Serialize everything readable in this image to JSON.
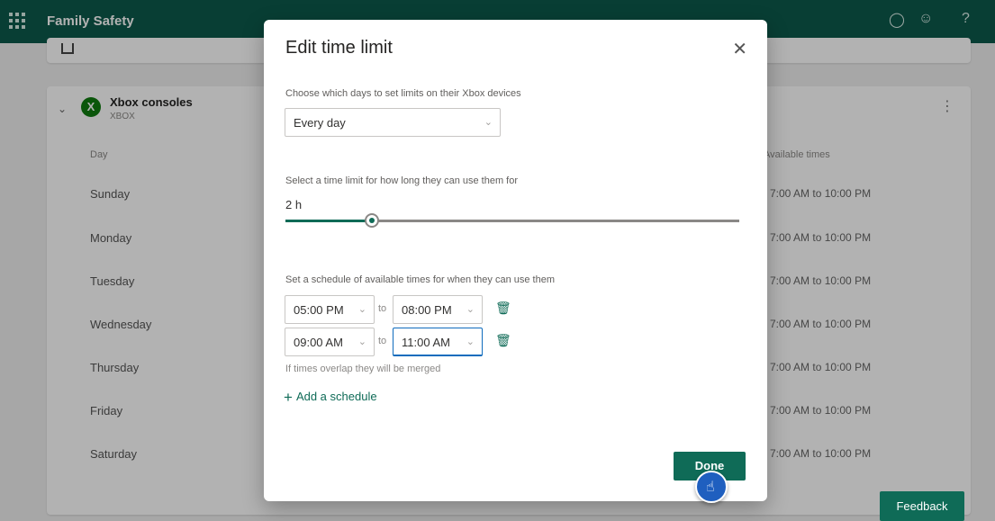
{
  "app": {
    "title": "Family Safety"
  },
  "top_icons": [
    "bell-icon",
    "people-icon",
    "help-icon"
  ],
  "background": {
    "device": {
      "name": "Xbox consoles",
      "subtitle": "XBOX"
    },
    "columns": {
      "day": "Day",
      "available": "Available times"
    },
    "days": [
      {
        "day": "Sunday",
        "times": "7:00 AM to 10:00 PM"
      },
      {
        "day": "Monday",
        "times": "7:00 AM to 10:00 PM"
      },
      {
        "day": "Tuesday",
        "times": "7:00 AM to 10:00 PM"
      },
      {
        "day": "Wednesday",
        "times": "7:00 AM to 10:00 PM"
      },
      {
        "day": "Thursday",
        "times": "7:00 AM to 10:00 PM"
      },
      {
        "day": "Friday",
        "times": "7:00 AM to 10:00 PM"
      },
      {
        "day": "Saturday",
        "times": "7:00 AM to 10:00 PM"
      }
    ],
    "feedback_label": "Feedback"
  },
  "dialog": {
    "title": "Edit time limit",
    "days_label": "Choose which days to set limits on their Xbox devices",
    "days_value": "Every day",
    "limit_label": "Select a time limit for how long they can use them for",
    "limit_value": "2 h",
    "limit_fraction": 0.19,
    "schedule_label": "Set a schedule of available times for when they can use them",
    "schedules": [
      {
        "from": "05:00 PM",
        "to_word": "to",
        "to": "08:00 PM"
      },
      {
        "from": "09:00 AM",
        "to_word": "to",
        "to": "11:00 AM"
      }
    ],
    "merge_note": "If times overlap they will be merged",
    "add_schedule": "Add a schedule",
    "done_label": "Done"
  },
  "colors": {
    "brand": "#0c5a4b",
    "accent": "#0f6b57",
    "focus": "#0f6cbd"
  }
}
